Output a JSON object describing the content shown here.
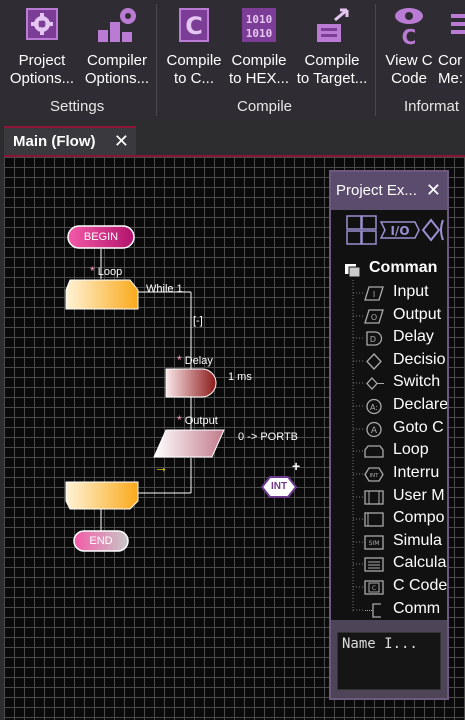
{
  "ribbon": {
    "buttons": [
      {
        "line1": "Project",
        "line2": "Options..."
      },
      {
        "line1": "Compiler",
        "line2": "Options..."
      },
      {
        "line1": "Compile",
        "line2": "to C..."
      },
      {
        "line1": "Compile",
        "line2": "to HEX..."
      },
      {
        "line1": "Compile",
        "line2": "to Target..."
      },
      {
        "line1": "View C",
        "line2": "Code"
      },
      {
        "line1": "Cor",
        "line2": "Me:"
      }
    ],
    "groups": [
      "Settings",
      "Compile",
      "Informat"
    ]
  },
  "tabs": [
    {
      "label": "Main (Flow)"
    }
  ],
  "flow": {
    "begin": "BEGIN",
    "end": "END",
    "loop_label": "Loop",
    "loop_condition": "While 1",
    "loop_collapse": "[-]",
    "delay_label": "Delay",
    "delay_value": "1 ms",
    "output_label": "Output",
    "output_value": "0 -> PORTB",
    "int_label": "INT",
    "cursor_arrow": "→"
  },
  "panel": {
    "title": "Project Ex...",
    "toolbar_text": "I/O",
    "root": "Comman",
    "items": [
      "Input",
      "Output",
      "Delay",
      "Decisio",
      "Switch",
      "Declare",
      "Goto C",
      "Loop",
      "Interru",
      "User M",
      "Compo",
      "Simula",
      "Calcula",
      "C Code",
      "Comm"
    ],
    "name_field": "Name I..."
  },
  "colors": {
    "accent": "#8a1538",
    "begin_fill": "#e0338a",
    "loop_fill": "#fbbf3d",
    "delay_fill": "#8c1a1a",
    "panel_bg": "#4d4458",
    "ribbon_icon": "#b97bd4"
  }
}
